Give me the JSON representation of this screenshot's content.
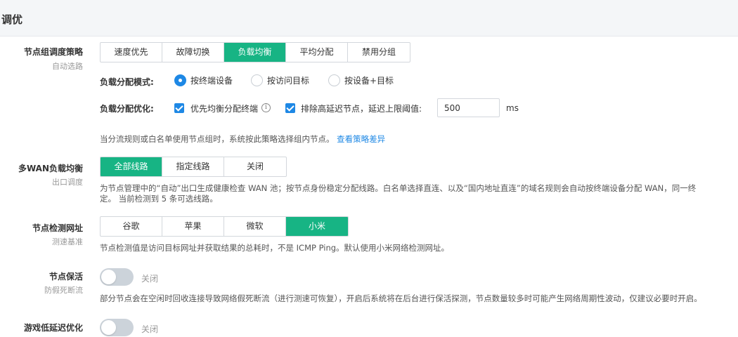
{
  "header": {
    "title": "调优"
  },
  "node_group_strategy": {
    "label": "节点组调度策略",
    "sub": "自动选路",
    "options": [
      "速度优先",
      "故障切换",
      "负载均衡",
      "平均分配",
      "禁用分组"
    ],
    "selected": "负载均衡",
    "mode": {
      "label": "负载分配模式:",
      "options": [
        "按终端设备",
        "按访问目标",
        "按设备+目标"
      ],
      "selected": "按终端设备"
    },
    "optimize": {
      "label": "负载分配优化:",
      "balance_label": "优先均衡分配终端",
      "balance_checked": true,
      "exclude_label": "排除高延迟节点，延迟上限阈值:",
      "exclude_checked": true,
      "threshold_value": "500",
      "unit": "ms"
    },
    "desc": "当分流规则或白名单使用节点组时，系统按此策略选择组内节点。",
    "link": "查看策略差异"
  },
  "multiwan": {
    "label": "多WAN负载均衡",
    "sub": "出口调度",
    "options": [
      "全部线路",
      "指定线路",
      "关闭"
    ],
    "selected": "全部线路",
    "desc_line1": "为节点管理中的“自动”出口生成健康检查 WAN 池；按节点身份稳定分配线路。白名单选择直连、以及“国内地址直连”的域名规则会自动按终端设备分配 WAN，同一终",
    "desc_line2": "定。 当前检测到 5 条可选线路。"
  },
  "detect_url": {
    "label": "节点检测网址",
    "sub": "测速基准",
    "options": [
      "谷歌",
      "苹果",
      "微软",
      "小米"
    ],
    "selected": "小米",
    "desc": "节点检测值是访问目标网址并获取结果的总耗时，不是 ICMP Ping。默认使用小米网络检测网址。"
  },
  "keepalive": {
    "label": "节点保活",
    "sub": "防假死断流",
    "state": "关闭",
    "enabled": false,
    "desc": "部分节点会在空闲时回收连接导致网络假死断流（进行测速可恢复），开启后系统将在后台进行保活探测，节点数量较多时可能产生网络周期性波动，仅建议必要时开启。"
  },
  "game_latency": {
    "label": "游戏低延迟优化",
    "state": "关闭",
    "enabled": false
  },
  "colors": {
    "accent": "#17b484",
    "blue": "#1e88e5",
    "toggle_off": "#ccd3da"
  }
}
